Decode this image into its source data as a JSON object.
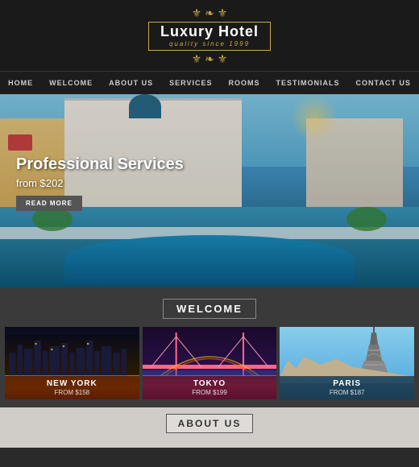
{
  "header": {
    "logo_ornament_top": "✦ ❧ ✦",
    "logo_text": "Luxury Hotel",
    "logo_subtitle": "quality since 1999",
    "logo_ornament_bottom": "✦ ❧ ✦"
  },
  "nav": {
    "items": [
      {
        "label": "HOME",
        "id": "home"
      },
      {
        "label": "WELCOME",
        "id": "welcome"
      },
      {
        "label": "ABOUT US",
        "id": "about"
      },
      {
        "label": "SERVICES",
        "id": "services"
      },
      {
        "label": "ROOMS",
        "id": "rooms"
      },
      {
        "label": "TESTIMONIALS",
        "id": "testimonials"
      },
      {
        "label": "CONTACT US",
        "id": "contact"
      }
    ]
  },
  "hero": {
    "title": "Professional Services",
    "price_text": "from $202",
    "read_more": "READ MORE"
  },
  "welcome": {
    "title": "WELCOME",
    "cities": [
      {
        "name": "NEW YORK",
        "price": "FROM $158",
        "id": "new-york"
      },
      {
        "name": "TOKYO",
        "price": "FROM $199",
        "id": "tokyo"
      },
      {
        "name": "PARIS",
        "price": "FROM $187",
        "id": "paris"
      }
    ]
  },
  "about": {
    "title": "ABOUT US"
  }
}
